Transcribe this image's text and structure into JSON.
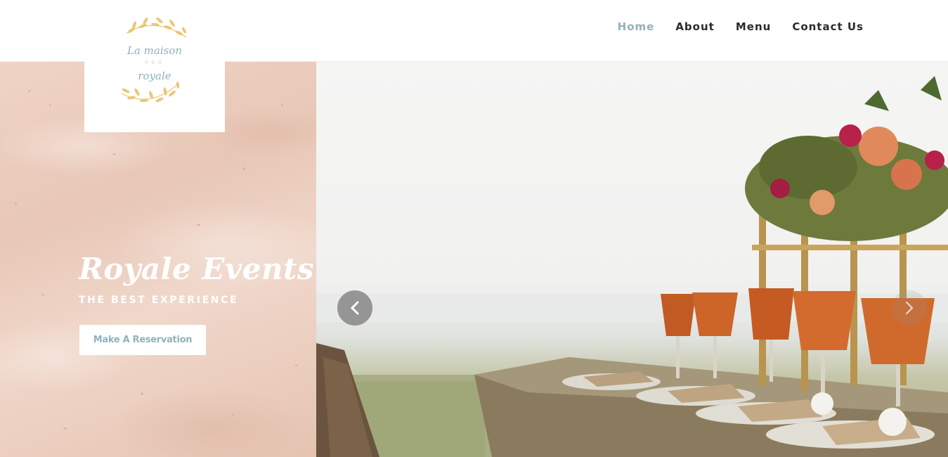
{
  "logo": {
    "line1": "La maison",
    "dots": "○○○",
    "line2": "royale"
  },
  "nav": {
    "items": [
      {
        "label": "Home",
        "active": true
      },
      {
        "label": "About",
        "active": false
      },
      {
        "label": "Menu",
        "active": false
      },
      {
        "label": "Contact Us",
        "active": false
      }
    ]
  },
  "hero": {
    "title": "Royale Events",
    "subtitle": "THE BEST EXPERIENCE",
    "cta_label": "Make A Reservation"
  },
  "slider": {
    "prev_icon": "chevron-left-icon",
    "next_icon": "chevron-right-icon"
  },
  "colors": {
    "accent": "#8fb3bd",
    "nav_text": "#2b2b2b",
    "panel": "#ecccbc",
    "logo_gold": "#e8c36a"
  }
}
